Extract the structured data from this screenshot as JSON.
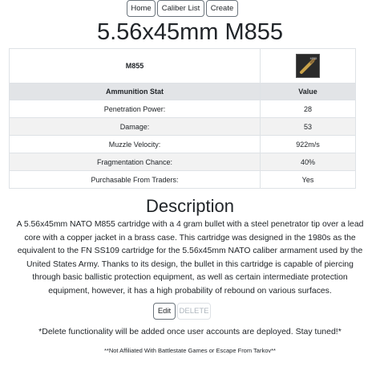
{
  "nav": {
    "home_label": "Home",
    "caliber_list_label": "Caliber List",
    "create_label": "Create"
  },
  "page_title": "5.56x45mm M855",
  "ammo": {
    "name": "M855",
    "image_label": "M855",
    "table_header": {
      "stat": "Ammunition Stat",
      "value": "Value"
    },
    "stats": [
      {
        "label": "Penetration Power:",
        "value": "28"
      },
      {
        "label": "Damage:",
        "value": "53"
      },
      {
        "label": "Muzzle Velocity:",
        "value": "922m/s"
      },
      {
        "label": "Fragmentation Chance:",
        "value": "40%"
      },
      {
        "label": "Purchasable From Traders:",
        "value": "Yes"
      }
    ]
  },
  "description": {
    "heading": "Description",
    "text": "A 5.56x45mm NATO M855 cartridge with a 4 gram bullet with a steel penetrator tip over a lead core with a copper jacket in a brass case. This cartridge was designed in the 1980s as the equivalent to the FN SS109 cartridge for the 5.56x45mm NATO caliber armament used by the United States Army. Thanks to its design, the bullet in this cartridge is capable of piercing through basic ballistic protection equipment, as well as certain intermediate protection equipment, however, it has a high probability of rebound on various surfaces."
  },
  "actions": {
    "edit_label": "Edit",
    "delete_label": "DELETE"
  },
  "notice": "*Delete functionality will be added once user accounts are deployed. Stay tuned!*",
  "footer": "**Not Affiliated With Battlestate Games or Escape From Tarkov**",
  "colors": {
    "secondary_border": "#6c757d",
    "disabled_text": "#adb5bd",
    "table_header_bg": "#e2e4e7",
    "table_stripe_bg": "#f2f2f2"
  }
}
